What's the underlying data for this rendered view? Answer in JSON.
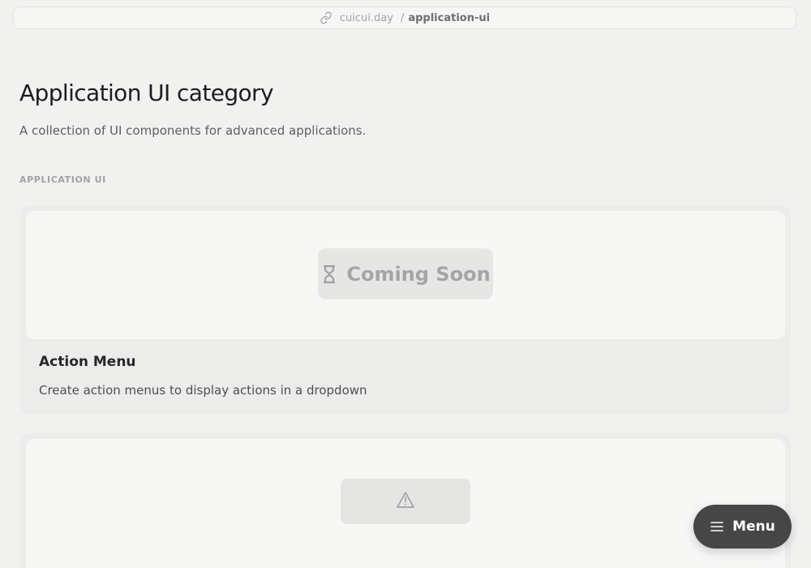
{
  "breadcrumb": {
    "domain": "cuicui.day",
    "separator": "/",
    "current": "application-ui",
    "icon": "link-icon"
  },
  "page": {
    "title": "Application UI category",
    "subtitle": "A collection of UI components for advanced applications."
  },
  "section": {
    "label": "APPLICATION UI"
  },
  "cards": [
    {
      "badge": "Coming Soon",
      "badge_icon": "hourglass-icon",
      "title": "Action Menu",
      "description": "Create action menus to display actions in a dropdown"
    },
    {
      "badge_icon": "warning-icon"
    }
  ],
  "menu_button": {
    "label": "Menu",
    "icon": "menu-icon"
  },
  "colors": {
    "background": "#f1f1f0",
    "card": "#ececeb",
    "preview": "#f7f7f6",
    "menu_button": "#464646"
  }
}
